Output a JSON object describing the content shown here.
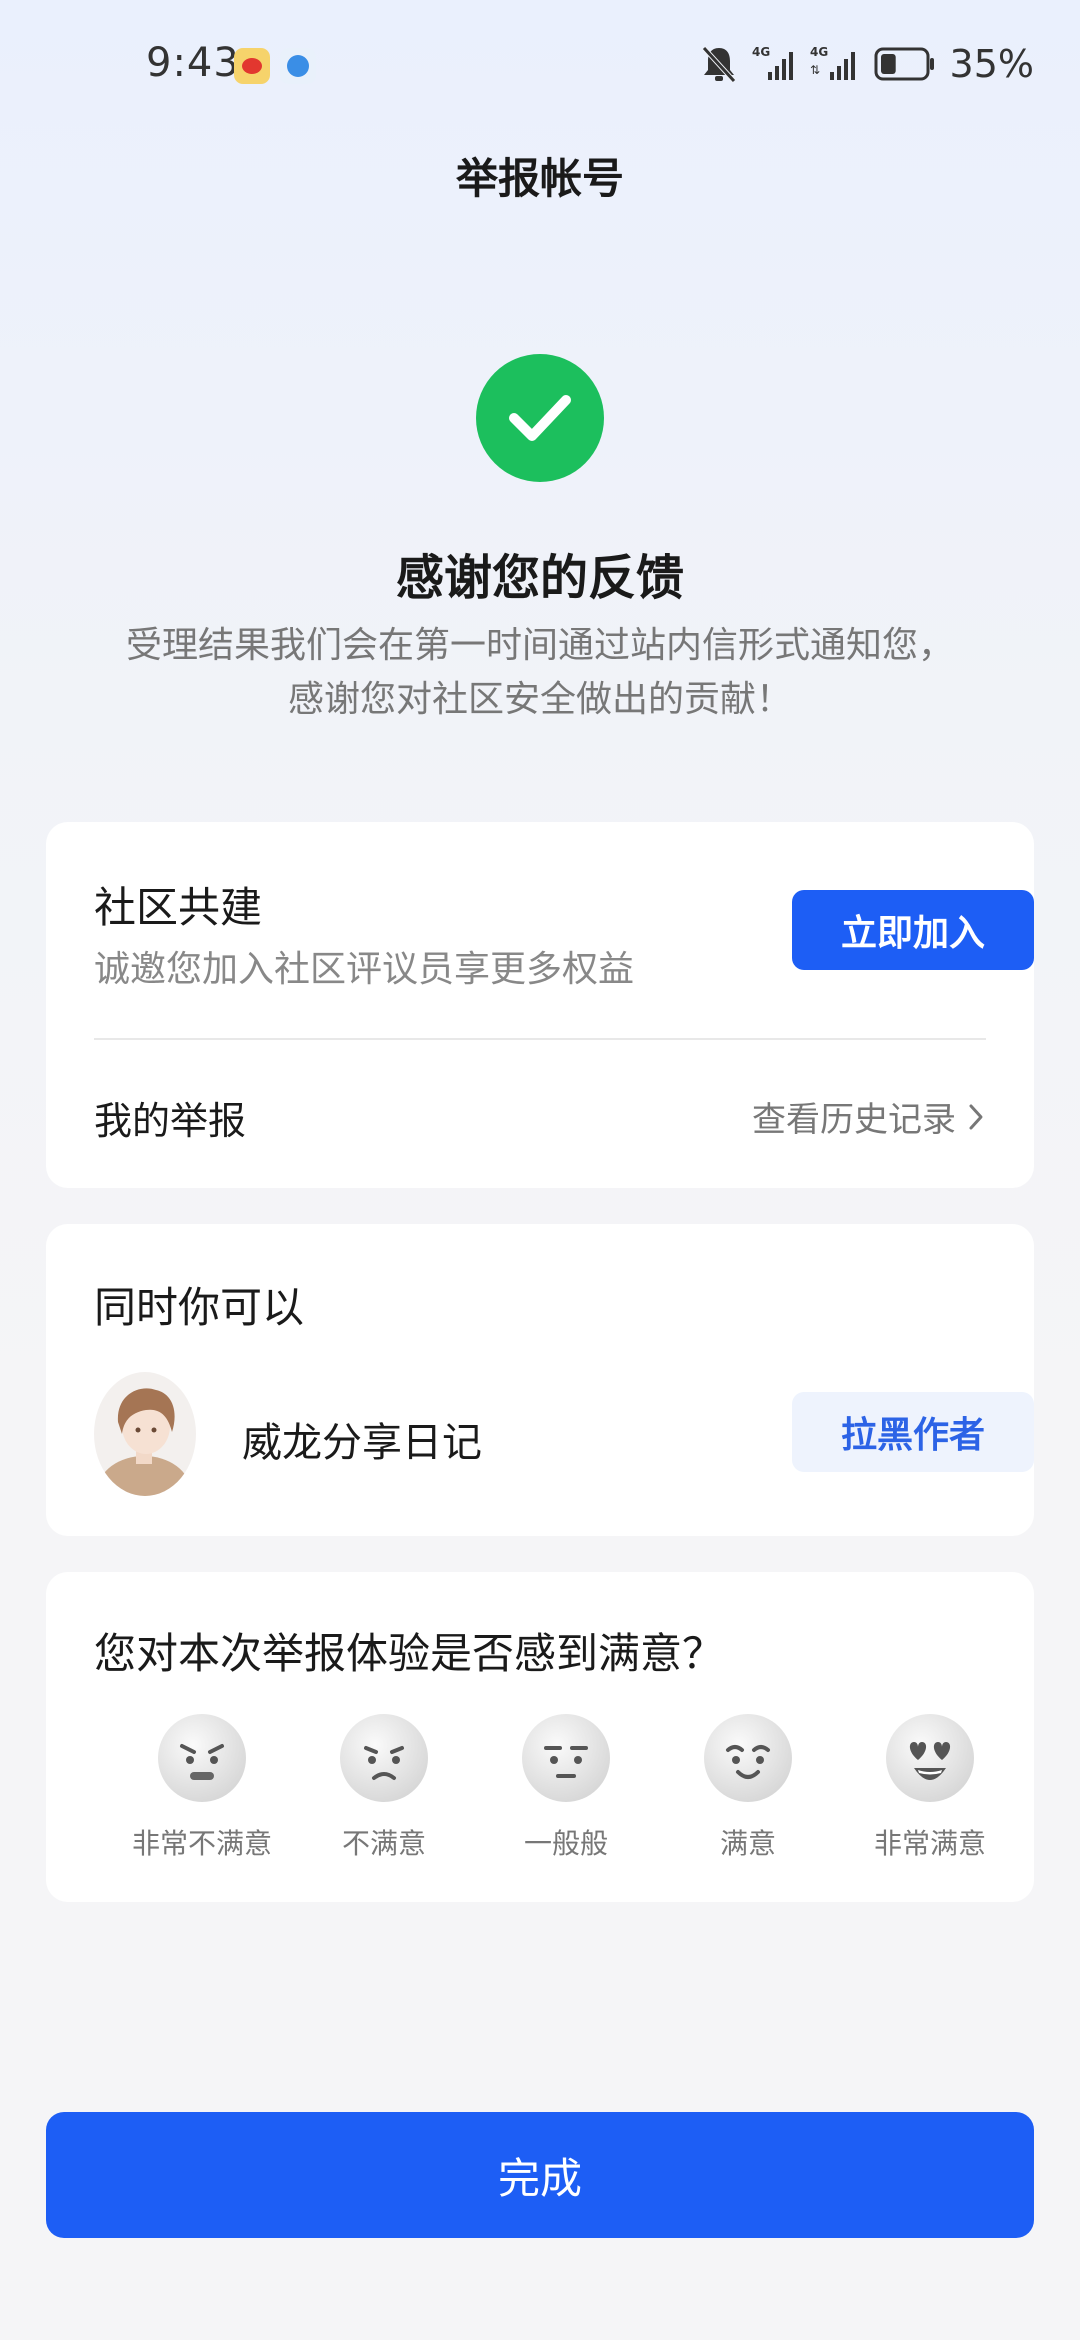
{
  "status_bar": {
    "time": "9:43",
    "network_1": "4G",
    "network_2": "4G",
    "battery": "35%",
    "battery_level": 0.35
  },
  "header": {
    "title": "举报帐号"
  },
  "success": {
    "title": "感谢您的反馈",
    "line1": "受理结果我们会在第一时间通过站内信形式通知您，",
    "line2": "感谢您对社区安全做出的贡献！",
    "color": "#1cbf5d"
  },
  "community": {
    "title": "社区共建",
    "subtitle": "诚邀您加入社区评议员享更多权益",
    "join_label": "立即加入",
    "my_report_label": "我的举报",
    "history_label": "查看历史记录"
  },
  "actions": {
    "title": "同时你可以",
    "author_name": "威龙分享日记",
    "block_label": "拉黑作者"
  },
  "survey": {
    "question": "您对本次举报体验是否感到满意？",
    "options": [
      {
        "label": "非常不满意",
        "icon": "very-unsatisfied-face-icon"
      },
      {
        "label": "不满意",
        "icon": "unsatisfied-face-icon"
      },
      {
        "label": "一般般",
        "icon": "neutral-face-icon"
      },
      {
        "label": "满意",
        "icon": "satisfied-face-icon"
      },
      {
        "label": "非常满意",
        "icon": "very-satisfied-face-icon"
      }
    ]
  },
  "footer": {
    "done_label": "完成"
  },
  "colors": {
    "primary": "#1d5ef5",
    "success": "#1cbf5d",
    "block_bg": "#eef3fd"
  }
}
